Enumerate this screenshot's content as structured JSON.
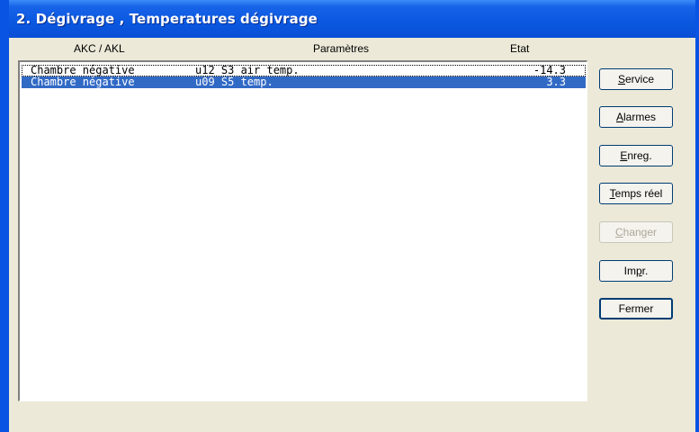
{
  "window": {
    "title": "2. Dégivrage , Temperatures dégivrage"
  },
  "columns": {
    "akc": "AKC / AKL",
    "parametres": "Paramètres",
    "etat": "Etat"
  },
  "rows": [
    {
      "akc": "Chambre négative",
      "param": "u12 S3 air temp.",
      "value": "-14.3",
      "selected": false,
      "focused": true
    },
    {
      "akc": "Chambre négative",
      "param": "u09 S5 temp.",
      "value": "3.3",
      "selected": true,
      "focused": false
    }
  ],
  "buttons": {
    "service": {
      "first": "S",
      "rest": "ervice"
    },
    "alarmes": {
      "first": "A",
      "rest": "larmes"
    },
    "enreg": {
      "first": "E",
      "rest": "nreg."
    },
    "temps_reel": {
      "first": "T",
      "rest": "emps réel"
    },
    "changer": {
      "first": "C",
      "rest": "hanger",
      "disabled": true
    },
    "impr": {
      "pre": "Im",
      "under": "p",
      "rest": "r."
    },
    "fermer": {
      "label": "Fermer",
      "default": true
    }
  },
  "colors": {
    "titlebar": "#0a58e0",
    "selection": "#316ac5",
    "face": "#ece9d8"
  }
}
